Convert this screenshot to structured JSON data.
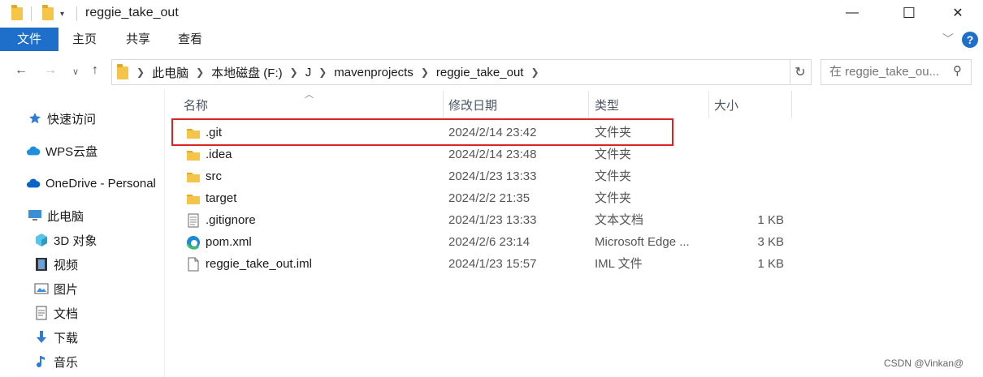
{
  "window": {
    "title": "reggie_take_out",
    "minimize_icon": "—",
    "maximize_icon": "☐",
    "close_icon": "✕"
  },
  "ribbon": {
    "tabs": [
      {
        "label": "文件",
        "active": true
      },
      {
        "label": "主页",
        "active": false
      },
      {
        "label": "共享",
        "active": false
      },
      {
        "label": "查看",
        "active": false
      }
    ],
    "help_label": "?"
  },
  "address": {
    "crumbs": [
      "此电脑",
      "本地磁盘 (F:)",
      "J",
      "mavenprojects",
      "reggie_take_out"
    ]
  },
  "search": {
    "placeholder": "在 reggie_take_ou..."
  },
  "sidebar": {
    "items": [
      {
        "label": "快速访问",
        "icon": "star-icon"
      },
      {
        "label": "WPS云盘",
        "icon": "cloud-icon"
      },
      {
        "label": "OneDrive - Personal",
        "icon": "onedrive-icon"
      },
      {
        "label": "此电脑",
        "icon": "computer-icon"
      },
      {
        "label": "3D 对象",
        "icon": "cube-3d-icon"
      },
      {
        "label": "视频",
        "icon": "video-icon"
      },
      {
        "label": "图片",
        "icon": "picture-icon"
      },
      {
        "label": "文档",
        "icon": "document-icon"
      },
      {
        "label": "下载",
        "icon": "download-icon"
      },
      {
        "label": "音乐",
        "icon": "music-icon"
      }
    ]
  },
  "columns": {
    "name": "名称",
    "date": "修改日期",
    "type": "类型",
    "size": "大小"
  },
  "files": [
    {
      "name": ".git",
      "date": "2024/2/14 23:42",
      "type": "文件夹",
      "size": "",
      "icon": "folder-icon"
    },
    {
      "name": ".idea",
      "date": "2024/2/14 23:48",
      "type": "文件夹",
      "size": "",
      "icon": "folder-icon"
    },
    {
      "name": "src",
      "date": "2024/1/23 13:33",
      "type": "文件夹",
      "size": "",
      "icon": "folder-icon"
    },
    {
      "name": "target",
      "date": "2024/2/2 21:35",
      "type": "文件夹",
      "size": "",
      "icon": "folder-icon"
    },
    {
      "name": ".gitignore",
      "date": "2024/1/23 13:33",
      "type": "文本文档",
      "size": "1 KB",
      "icon": "text-file-icon"
    },
    {
      "name": "pom.xml",
      "date": "2024/2/6 23:14",
      "type": "Microsoft Edge ...",
      "size": "3 KB",
      "icon": "edge-icon"
    },
    {
      "name": "reggie_take_out.iml",
      "date": "2024/1/23 15:57",
      "type": "IML 文件",
      "size": "1 KB",
      "icon": "file-icon"
    }
  ],
  "watermark": "CSDN @Vinkan@",
  "colors": {
    "accent": "#1e6fc9",
    "highlight_border": "#dd2222",
    "folder": "#f5c54a"
  }
}
